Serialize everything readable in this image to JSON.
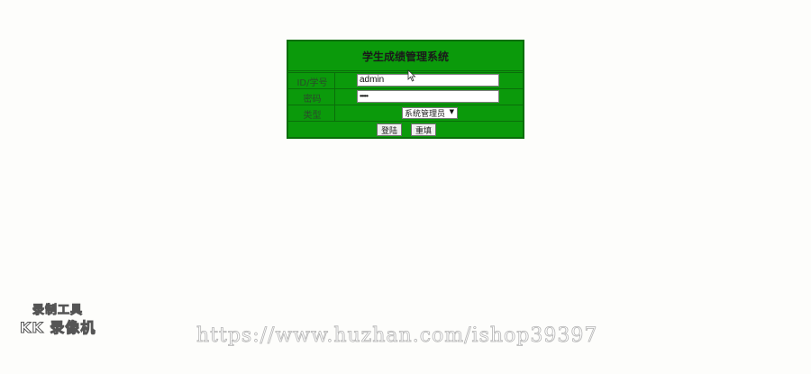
{
  "login_form": {
    "title": "学生成绩管理系统",
    "id_label": "ID/学号",
    "id_value": "admin",
    "password_label": "密码",
    "password_value": "•••••",
    "type_label": "类型",
    "type_selected": "系统管理员",
    "login_button": "登陆",
    "reset_button": "重填"
  },
  "watermarks": {
    "logo_line1": "录制工具",
    "logo_line2": "KK 录像机",
    "url": "https://www.huzhan.com/ishop39397"
  },
  "colors": {
    "panel_green": "#0b9a0b",
    "border_green": "#0a6e0a",
    "page_background": "#fdfdfb"
  },
  "icons": {
    "cursor": "mouse-pointer-icon",
    "select_arrow": "dropdown-arrow-icon"
  }
}
